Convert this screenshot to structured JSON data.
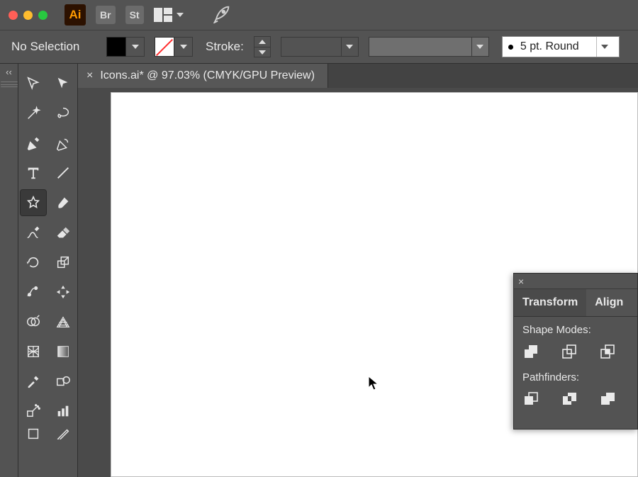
{
  "appbar": {
    "logo": "Ai",
    "tabs": [
      "Br",
      "St"
    ]
  },
  "controlbar": {
    "selection_label": "No Selection",
    "stroke_label": "Stroke:",
    "brush_label": "5 pt. Round"
  },
  "document": {
    "tab_title": "Icons.ai* @ 97.03% (CMYK/GPU Preview)"
  },
  "gutter": {
    "collapse_glyph": "‹‹"
  },
  "panel": {
    "tabs": [
      "Transform",
      "Align"
    ],
    "section_shape": "Shape Modes:",
    "section_path": "Pathfinders:"
  }
}
